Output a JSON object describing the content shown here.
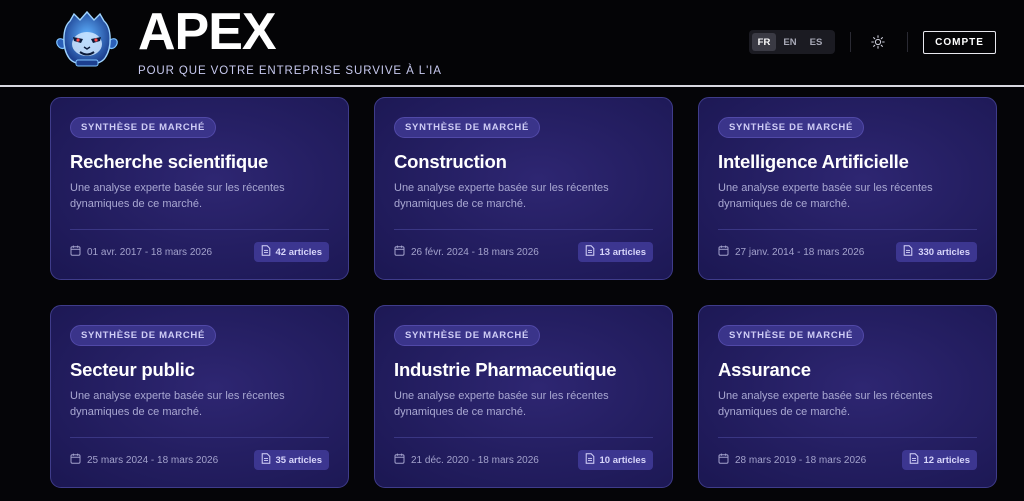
{
  "header": {
    "brand": "APEX",
    "tagline": "POUR QUE VOTRE ENTREPRISE SURVIVE À L'IA",
    "logo_icon": "monkey-mascot-icon",
    "languages": [
      {
        "code": "FR",
        "active": true
      },
      {
        "code": "EN",
        "active": false
      },
      {
        "code": "ES",
        "active": false
      }
    ],
    "theme_icon": "sun-icon",
    "account_label": "COMPTE"
  },
  "cards": [
    {
      "tag": "SYNTHÈSE DE MARCHÉ",
      "title": "Recherche scientifique",
      "description": "Une analyse experte basée sur les récentes dynamiques de ce marché.",
      "date_range": "01 avr. 2017 - 18 mars 2026",
      "count": "42 articles"
    },
    {
      "tag": "SYNTHÈSE DE MARCHÉ",
      "title": "Construction",
      "description": "Une analyse experte basée sur les récentes dynamiques de ce marché.",
      "date_range": "26 févr. 2024 - 18 mars 2026",
      "count": "13 articles"
    },
    {
      "tag": "SYNTHÈSE DE MARCHÉ",
      "title": "Intelligence Artificielle",
      "description": "Une analyse experte basée sur les récentes dynamiques de ce marché.",
      "date_range": "27 janv. 2014 - 18 mars 2026",
      "count": "330 articles"
    },
    {
      "tag": "SYNTHÈSE DE MARCHÉ",
      "title": "Secteur public",
      "description": "Une analyse experte basée sur les récentes dynamiques de ce marché.",
      "date_range": "25 mars 2024 - 18 mars 2026",
      "count": "35 articles"
    },
    {
      "tag": "SYNTHÈSE DE MARCHÉ",
      "title": "Industrie Pharmaceutique",
      "description": "Une analyse experte basée sur les récentes dynamiques de ce marché.",
      "date_range": "21 déc. 2020 - 18 mars 2026",
      "count": "10 articles"
    },
    {
      "tag": "SYNTHÈSE DE MARCHÉ",
      "title": "Assurance",
      "description": "Une analyse experte basée sur les récentes dynamiques de ce marché.",
      "date_range": "28 mars 2019 - 18 mars 2026",
      "count": "12 articles"
    }
  ],
  "icons": {
    "date": "calendar-icon",
    "count": "document-icon"
  },
  "colors": {
    "background": "#050508",
    "card": "#251f63",
    "accent": "#3a348a"
  }
}
